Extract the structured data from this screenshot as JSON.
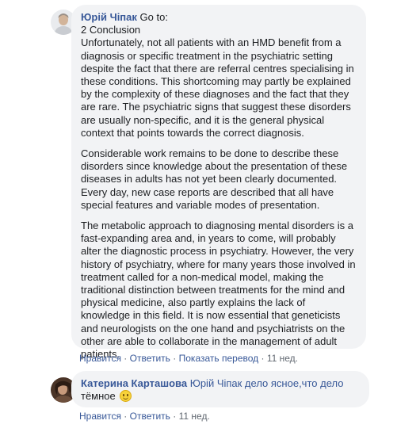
{
  "comments": [
    {
      "author": "Юрій Чіпак",
      "heading_lines": [
        "Go to:",
        "2 Conclusion"
      ],
      "paragraphs": [
        "Unfortunately, not all patients with an HMD benefit from a diagnosis or specific treatment in the psychiatric setting despite the fact that there are referral centres specialising in these conditions. This shortcoming may partly be explained by the complexity of these diagnoses and the fact that they are rare. The psychiatric signs that suggest these disorders are usually non-specific, and it is the general physical context that points towards the correct diagnosis.",
        "Considerable work remains to be done to describe these disorders since knowledge about the presentation of these diseases in adults has not yet been clearly documented. Every day, new case reports are described that all have special features and variable modes of presentation.",
        "The metabolic approach to diagnosing mental disorders is a fast-expanding area and, in years to come, will probably alter the diagnostic process in psychiatry. However, the very history of psychiatry, where for many years those involved in treatment called for a non-medical model, making the traditional distinction between treatments for the mind and physical medicine, also partly explains the lack of knowledge in this field. It is now essential that geneticists and neurologists on the one hand and psychiatrists on the other are able to collaborate in the management of adult patients."
      ],
      "actions": {
        "like": "Нравится",
        "reply": "Ответить",
        "translation": "Показать перевод",
        "time": "11 нед."
      }
    },
    {
      "author": "Катерина Карташова",
      "text_line1": "Юрій Чіпак дело ясное,что дело",
      "text_line2": "тёмное",
      "emoji": "slightly-smiling-face-emoji",
      "actions": {
        "like": "Нравится",
        "reply": "Ответить",
        "time": "11 нед."
      }
    }
  ],
  "separator": "·",
  "colors": {
    "author": "#385898",
    "bubble": "#f2f3f5",
    "meta": "#606770",
    "text": "#1c1e21"
  }
}
